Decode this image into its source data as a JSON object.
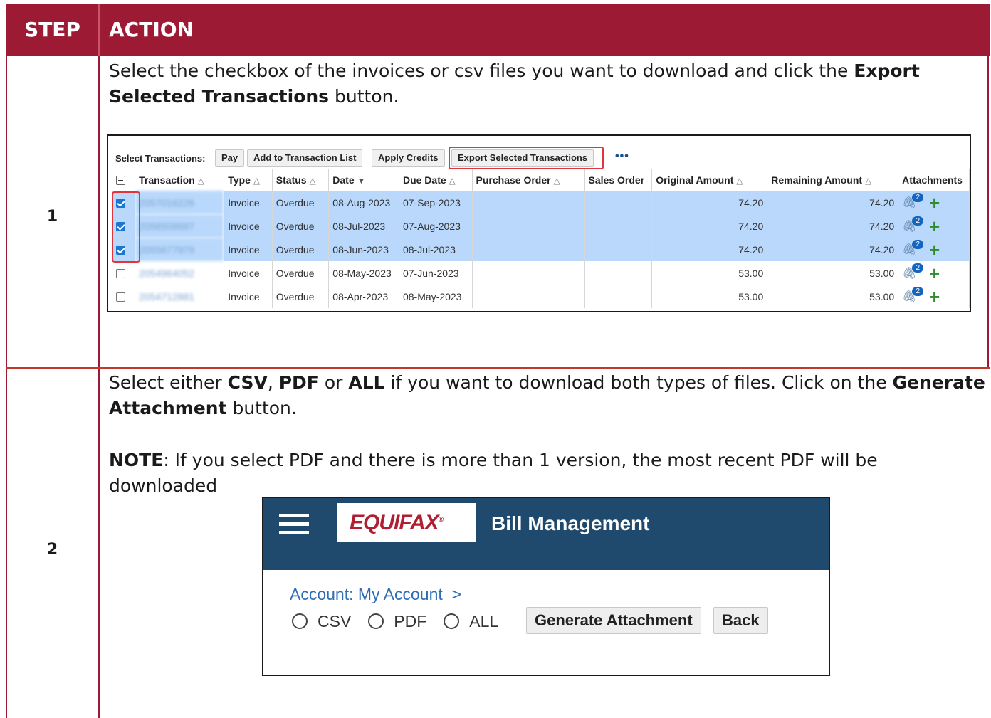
{
  "header": {
    "step": "STEP",
    "action": "ACTION"
  },
  "steps": [
    {
      "number": "1",
      "text_parts": [
        "Select the checkbox of the invoices or csv files you want to download and click the ",
        "Export Selected Transactions",
        " button."
      ],
      "screenshot": {
        "toolbar": {
          "label": "Select Transactions:",
          "buttons": [
            "Pay",
            "Add to Transaction List",
            "Apply Credits",
            "Export Selected Transactions"
          ],
          "more": "•••"
        },
        "columns": [
          "Transaction",
          "Type",
          "Status",
          "Date",
          "Due Date",
          "Purchase Order",
          "Sales Order",
          "Original Amount",
          "Remaining Amount",
          "Attachments"
        ],
        "rows": [
          {
            "selected": true,
            "transaction": "2057016226",
            "type": "Invoice",
            "status": "Overdue",
            "date": "08-Aug-2023",
            "due": "07-Sep-2023",
            "po": "",
            "so": "",
            "orig": "74.20",
            "rem": "74.20",
            "attach_count": "2"
          },
          {
            "selected": true,
            "transaction": "2056508687",
            "type": "Invoice",
            "status": "Overdue",
            "date": "08-Jul-2023",
            "due": "07-Aug-2023",
            "po": "",
            "so": "",
            "orig": "74.20",
            "rem": "74.20",
            "attach_count": "2"
          },
          {
            "selected": true,
            "transaction": "2055677979",
            "type": "Invoice",
            "status": "Overdue",
            "date": "08-Jun-2023",
            "due": "08-Jul-2023",
            "po": "",
            "so": "",
            "orig": "74.20",
            "rem": "74.20",
            "attach_count": "2"
          },
          {
            "selected": false,
            "transaction": "2054964052",
            "type": "Invoice",
            "status": "Overdue",
            "date": "08-May-2023",
            "due": "07-Jun-2023",
            "po": "",
            "so": "",
            "orig": "53.00",
            "rem": "53.00",
            "attach_count": "2"
          },
          {
            "selected": false,
            "transaction": "2054712881",
            "type": "Invoice",
            "status": "Overdue",
            "date": "08-Apr-2023",
            "due": "08-May-2023",
            "po": "",
            "so": "",
            "orig": "53.00",
            "rem": "53.00",
            "attach_count": "2"
          }
        ]
      }
    },
    {
      "number": "2",
      "text_parts": [
        "Select either ",
        "CSV",
        ", ",
        "PDF",
        " or ",
        "ALL",
        " if you want to download both types of files. Click on the ",
        "Generate Attachment",
        " button."
      ],
      "note_label": "NOTE",
      "note_text": ": If you select PDF and there is more than 1 version, the most recent PDF will be downloaded",
      "screenshot": {
        "logo": "EQUIFAX",
        "logo_mark": "®",
        "title": "Bill Management",
        "breadcrumb": "Account: My Account  >",
        "options": [
          "CSV",
          "PDF",
          "ALL"
        ],
        "generate_button": "Generate Attachment",
        "back_button": "Back"
      }
    }
  ],
  "colors": {
    "header_bg": "#9c1a33",
    "row_border": "#c0392b",
    "selected_row": "#b9d8fb",
    "equifax_header": "#1f4a6e",
    "equifax_red": "#b01e32",
    "highlight": "#e0353d"
  },
  "icons": [
    "checkbox-icon",
    "sort-arrow-icon",
    "paperclip-icon",
    "plus-icon",
    "hamburger-menu-icon",
    "radio-icon"
  ]
}
